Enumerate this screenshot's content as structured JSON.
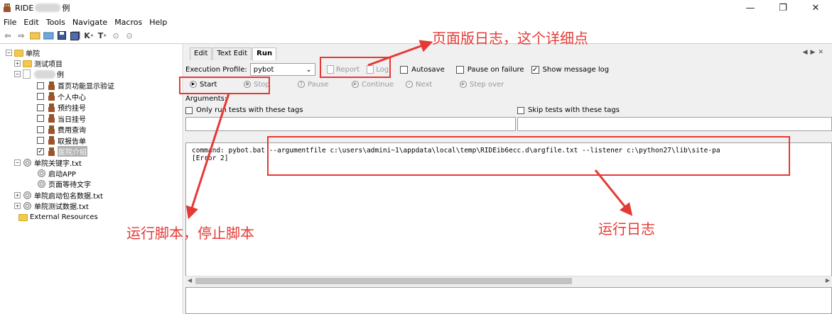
{
  "window": {
    "title_prefix": "RIDE",
    "title_suffix": "例",
    "controls": [
      "—",
      "❐",
      "✕"
    ]
  },
  "menu": [
    "File",
    "Edit",
    "Tools",
    "Navigate",
    "Macros",
    "Help"
  ],
  "toolbar_icons": [
    "back-arrow-icon",
    "forward-arrow-icon",
    "open-folder-icon",
    "open-directory-icon",
    "save-icon",
    "save-all-icon",
    "keyword-search-icon",
    "test-search-icon",
    "run-icon",
    "stop-icon"
  ],
  "tree": {
    "root": "单院",
    "project_folder": "测试项目",
    "suite_suffix": "例",
    "tests": [
      {
        "name": "首页功能显示验证",
        "checked": false
      },
      {
        "name": "个人中心",
        "checked": false
      },
      {
        "name": "预约挂号",
        "checked": false
      },
      {
        "name": "当日挂号",
        "checked": false
      },
      {
        "name": "费用查询",
        "checked": false
      },
      {
        "name": "取报告单",
        "checked": false
      },
      {
        "name": "医院介绍",
        "checked": true
      }
    ],
    "keyword_file": "单院关键字.txt",
    "keywords": [
      "启动APP",
      "页面等待文字"
    ],
    "files": [
      "单院启动包名数据.txt",
      "单院测试数据.txt"
    ],
    "external": "External Resources"
  },
  "tabs": [
    "Edit",
    "Text Edit",
    "Run"
  ],
  "run": {
    "profile_label": "Execution Profile:",
    "profile_value": "pybot",
    "report": "Report",
    "log": "Log",
    "autosave": "Autosave",
    "pause_on_failure": "Pause on failure",
    "show_message_log": "Show message log",
    "buttons": [
      "Start",
      "Stop",
      "Pause",
      "Continue",
      "Next",
      "Step over"
    ],
    "arguments_label": "Arguments:",
    "only_run_tags": "Only run tests with these tags",
    "skip_tags": "Skip tests with these tags",
    "log_text": "command: pybot.bat --argumentfile c:\\users\\admini~1\\appdata\\local\\temp\\RIDEib6ecc.d\\argfile.txt --listener c:\\python27\\lib\\site-pa\n[Error 2]"
  },
  "annotations": {
    "report_log": "页面版日志，这个详细点",
    "start_stop": "运行脚本，停止脚本",
    "run_log": "运行日志"
  },
  "colors": {
    "annotation_red": "#e53935",
    "folder_yellow": "#f2c94c"
  }
}
